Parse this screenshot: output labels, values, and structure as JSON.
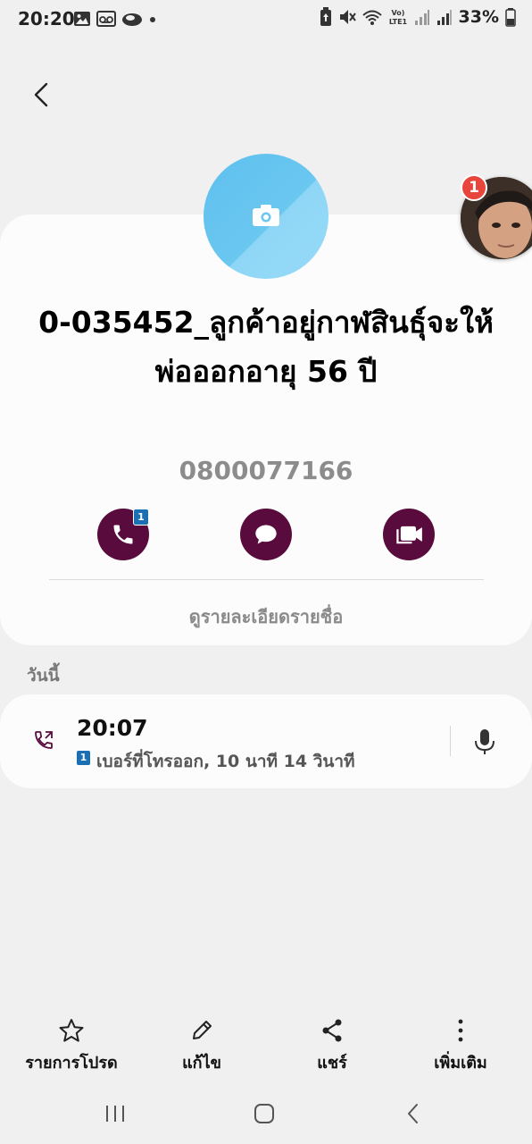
{
  "status_bar": {
    "time": "20:20",
    "battery": "33%",
    "left_icons": [
      "image-icon",
      "voicemail-icon",
      "cloud-icon",
      "dot-icon"
    ],
    "right_icons": [
      "battery-saver-icon",
      "mute-icon",
      "wifi-icon",
      "volte-icon",
      "signal-icon",
      "signal-icon"
    ]
  },
  "contact": {
    "name": "0-035452_ลูกค้าอยู่กาฬสินธุ์จะให้พ่อออกอายุ 56 ปี",
    "phone": "0800077166",
    "details_link": "ดูรายละเอียดรายชื่อ",
    "call_sim_badge": "1"
  },
  "history": {
    "section_label": "วันนี้",
    "entry": {
      "time": "20:07",
      "sim": "1",
      "description": "เบอร์ที่โทรออก, 10 นาที 14 วินาที"
    }
  },
  "floating_bubble": {
    "badge": "1"
  },
  "toolbar": {
    "favorite": "รายการโปรด",
    "edit": "แก้ไข",
    "share": "แชร์",
    "more": "เพิ่มเติม"
  },
  "colors": {
    "accent": "#5a0b3d",
    "background": "#f0f0f0",
    "card": "#fcfcfc",
    "avatar": "#6ac7f0",
    "badge_blue": "#1a6fb5",
    "notification_red": "#e8453c"
  }
}
